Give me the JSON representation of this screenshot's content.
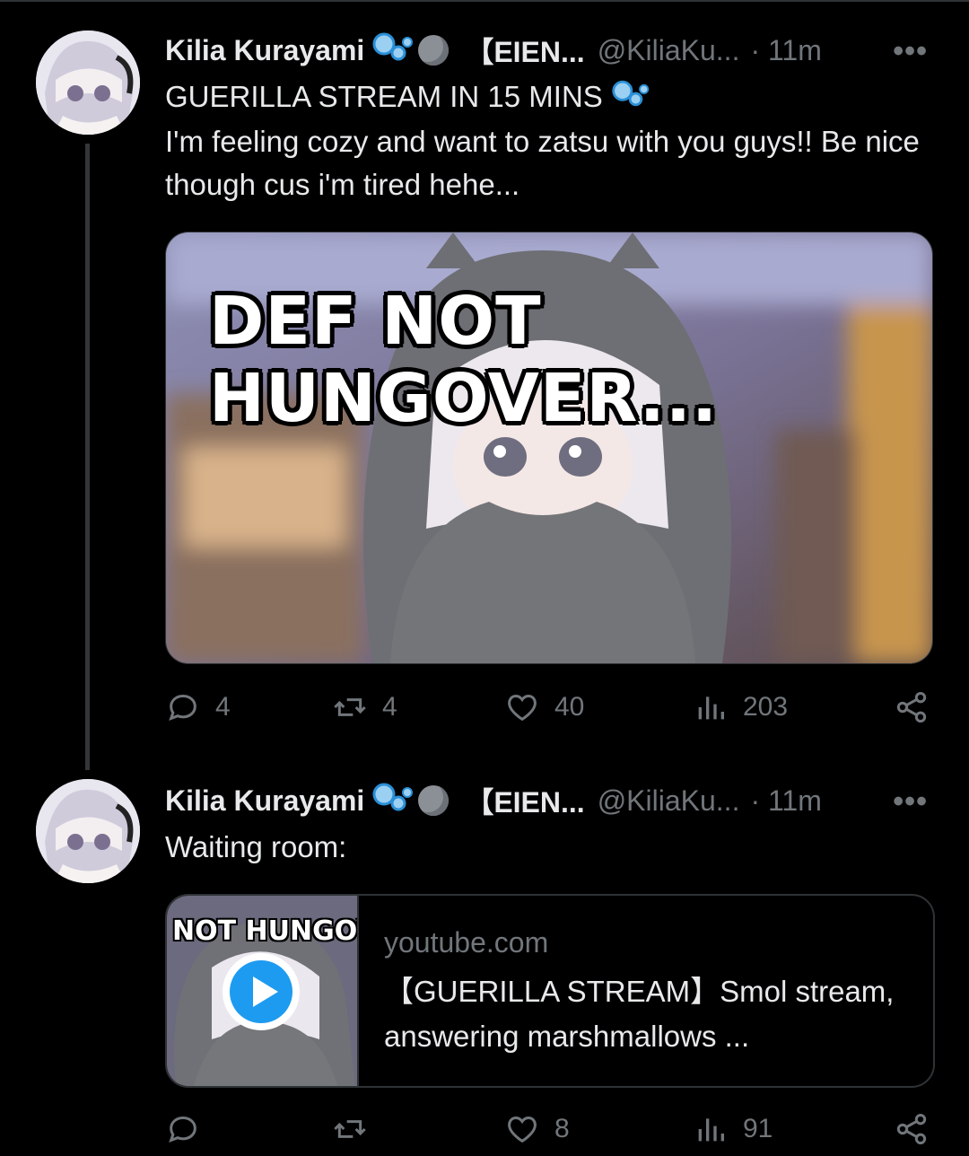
{
  "tweets": [
    {
      "display_name": "Kilia Kurayami",
      "badge_icon": "bubbles-icon",
      "affiliation": "【EIEN...",
      "handle": "@KiliaKu...",
      "time": "· 11m",
      "more": "•••",
      "text_line1": "GUERILLA STREAM IN 15 MINS",
      "text_body": "I'm feeling cozy and want to zatsu with you guys!! Be nice though cus i'm tired hehe...",
      "media_text": "DEF NOT HUNGOVER...",
      "replies": "4",
      "reposts": "4",
      "likes": "40",
      "views": "203"
    },
    {
      "display_name": "Kilia Kurayami",
      "badge_icon": "bubbles-icon",
      "affiliation": "【EIEN...",
      "handle": "@KiliaKu...",
      "time": "· 11m",
      "more": "•••",
      "text_body": "Waiting room:",
      "card": {
        "thumb_text": "NOT HUNGOVI",
        "domain": "youtube.com",
        "title": "【GUERILLA STREAM】Smol stream, answering marshmallows ..."
      },
      "replies": "",
      "reposts": "",
      "likes": "8",
      "views": "91"
    }
  ],
  "colors": {
    "background": "#000000",
    "text": "#e7e9ea",
    "muted": "#71767b",
    "accent": "#1d9bf0",
    "border": "#2f3336"
  }
}
